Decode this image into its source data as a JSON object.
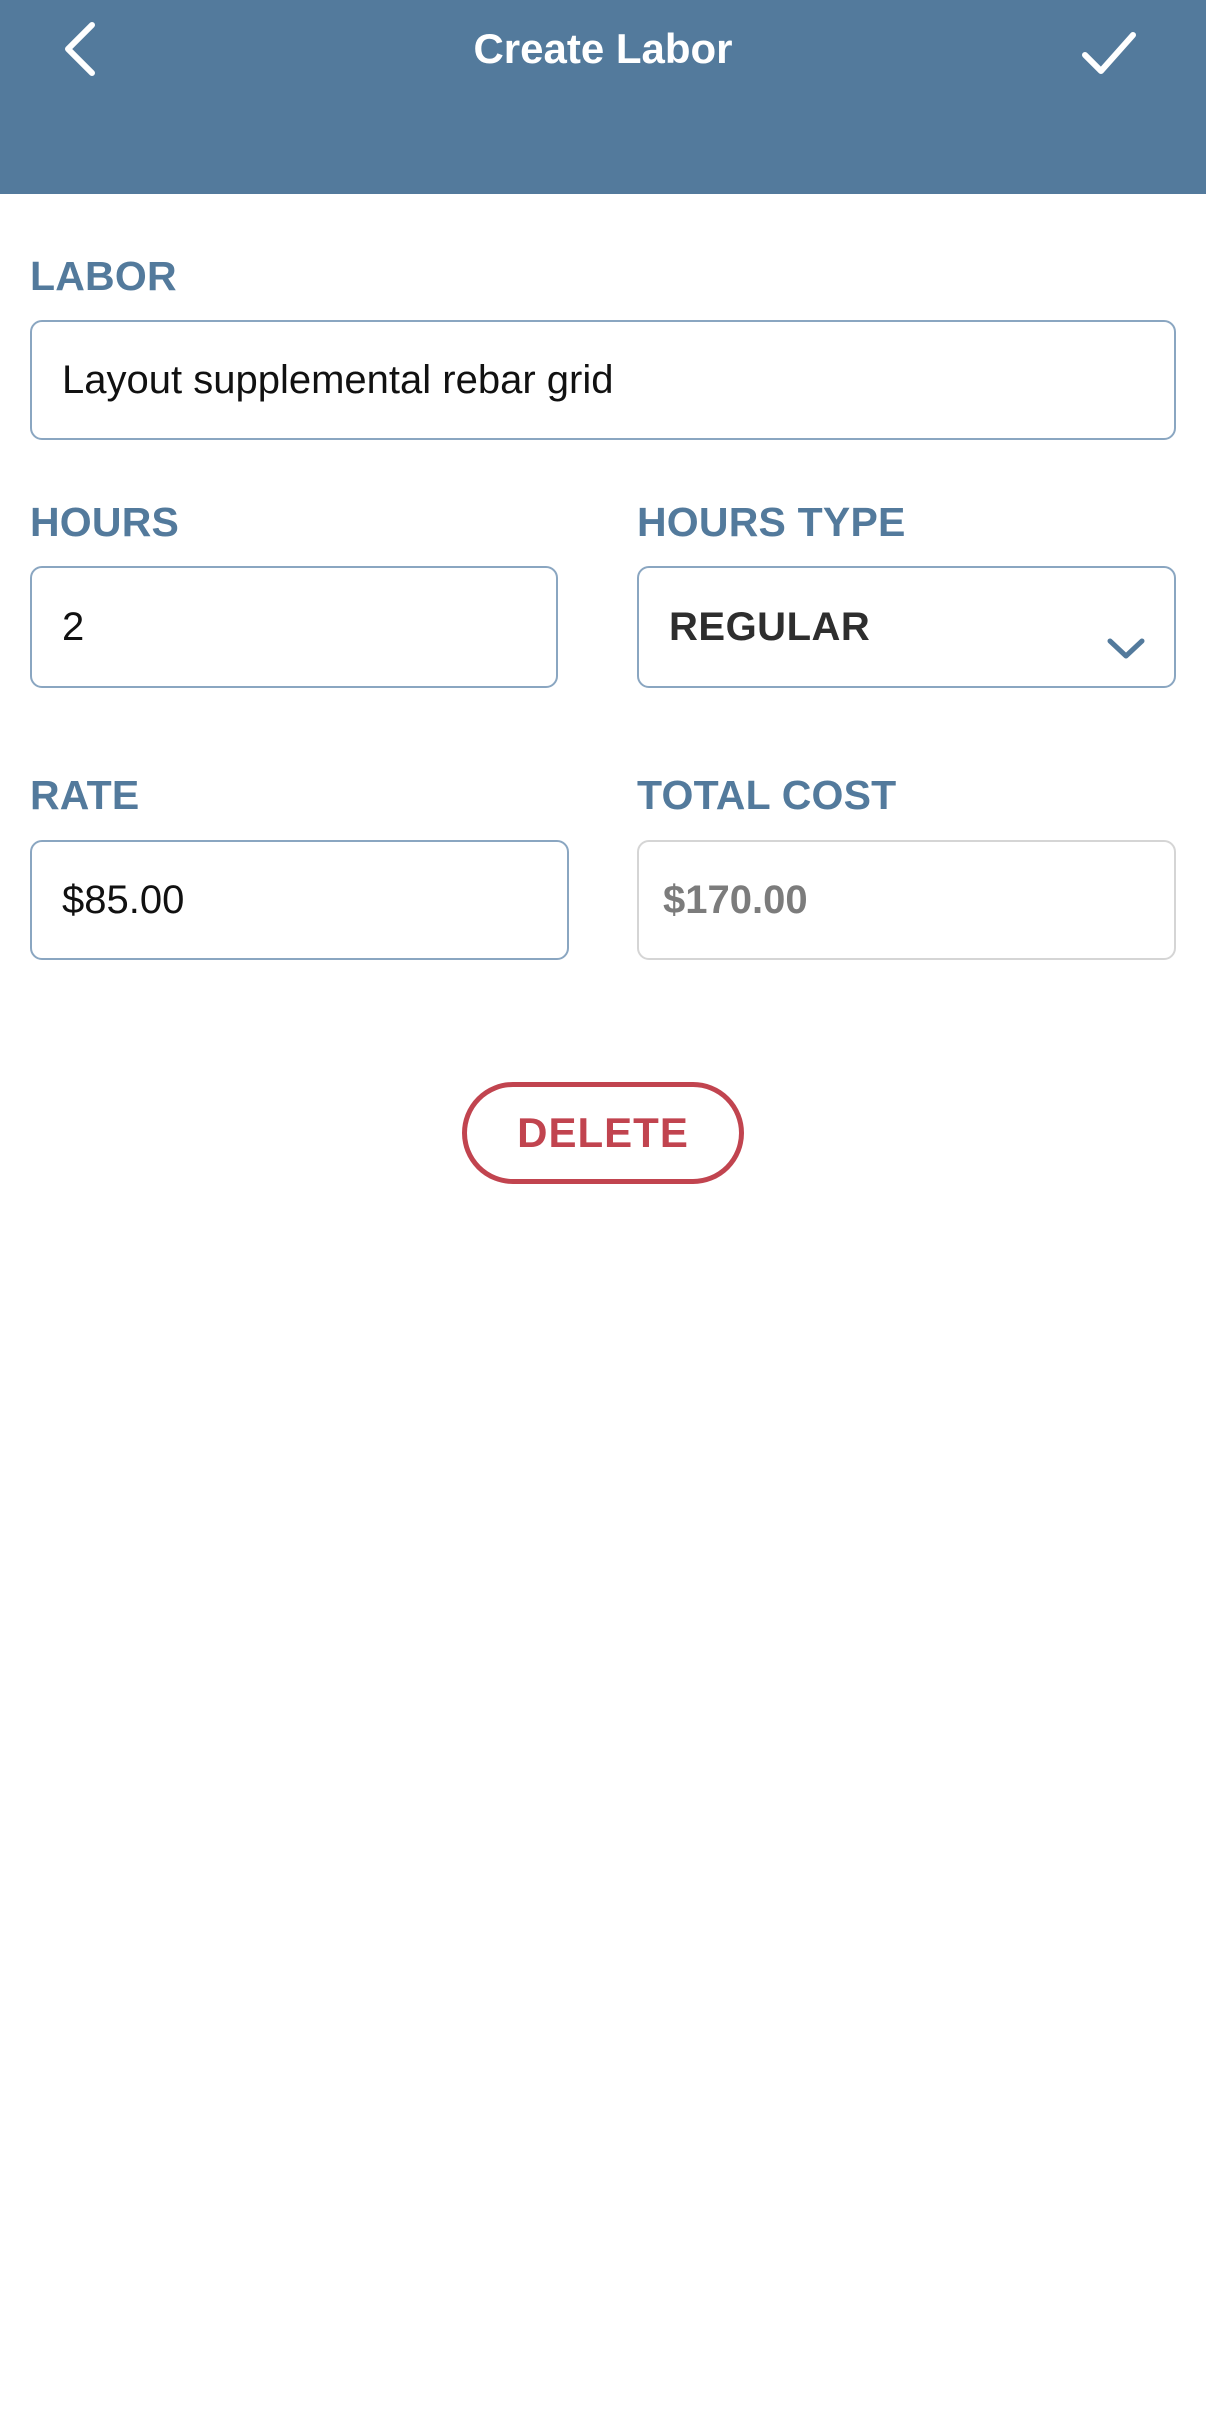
{
  "header": {
    "title": "Create Labor",
    "back_icon": "chevron-left-icon",
    "confirm_icon": "checkmark-icon",
    "background_color": "#537a9c"
  },
  "form": {
    "labor": {
      "label": "LABOR",
      "value": "Layout supplemental rebar grid"
    },
    "hours": {
      "label": "HOURS",
      "value": "2"
    },
    "hours_type": {
      "label": "HOURS TYPE",
      "value": "REGULAR",
      "icon": "chevron-down-icon"
    },
    "rate": {
      "label": "RATE",
      "value": "$85.00"
    },
    "total_cost": {
      "label": "TOTAL COST",
      "value": "$170.00"
    }
  },
  "actions": {
    "delete_label": "DELETE",
    "delete_color": "#c1444f"
  },
  "colors": {
    "accent": "#537a9c",
    "field_border": "#8aa6c1"
  }
}
